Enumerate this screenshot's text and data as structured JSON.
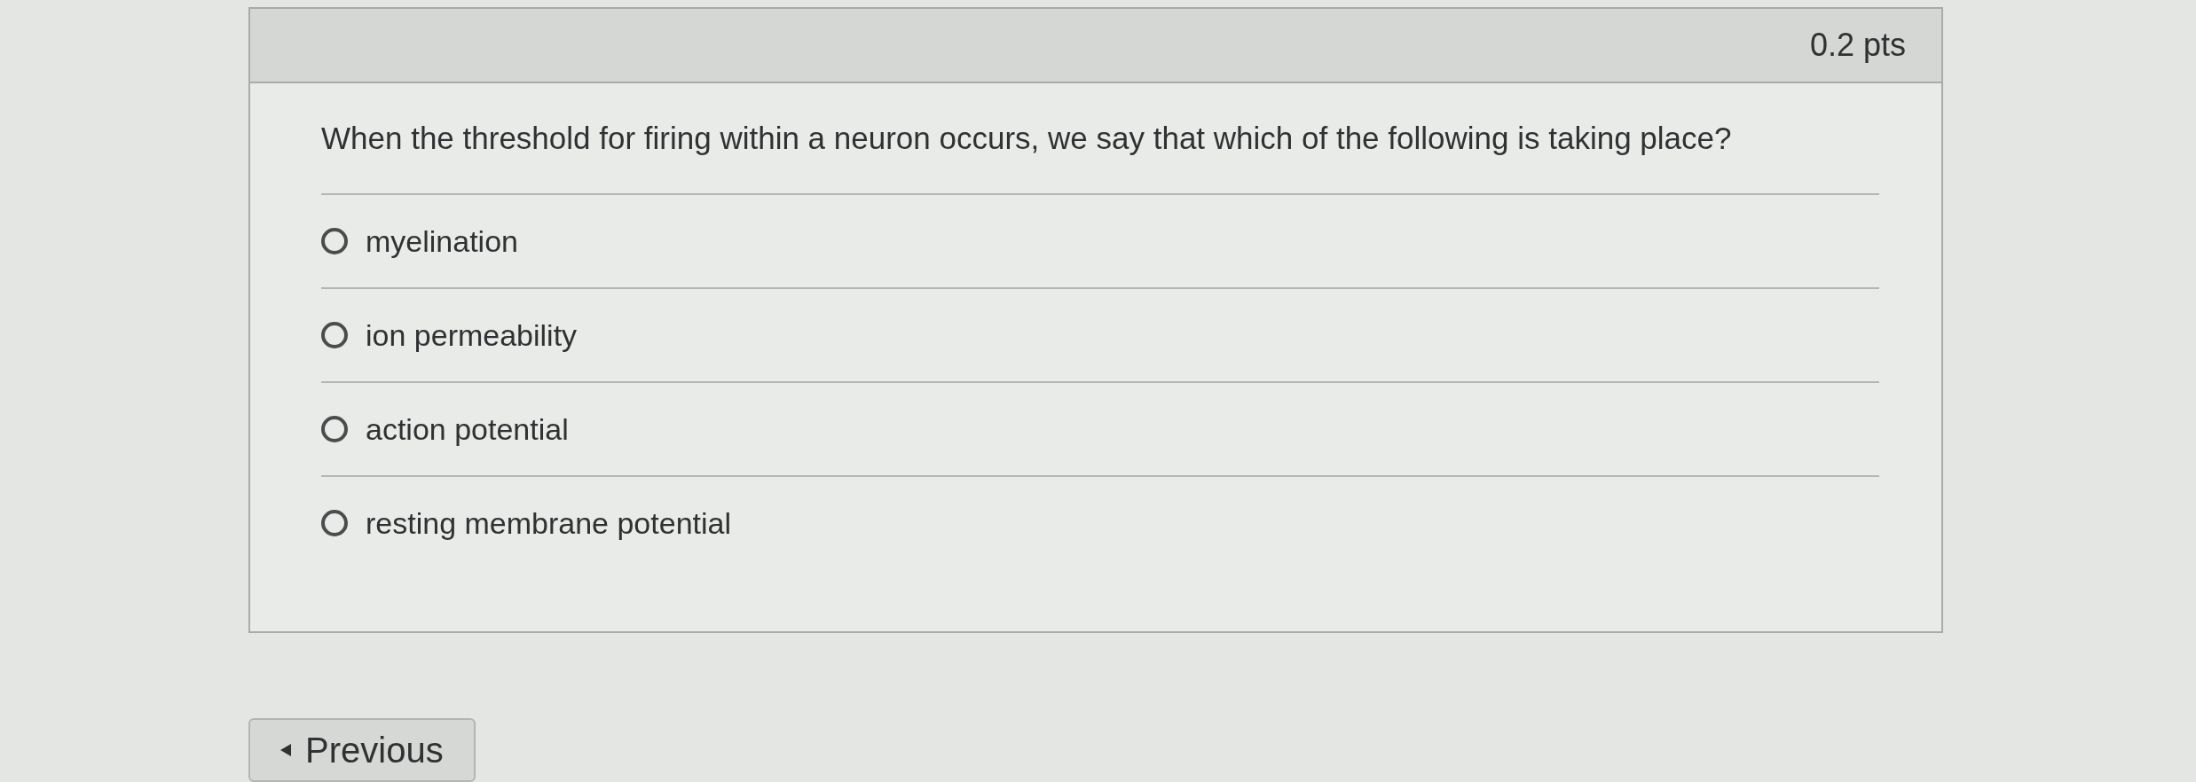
{
  "question": {
    "points": "0.2 pts",
    "text": "When the threshold for firing within a neuron occurs, we say that which of the following is taking place?",
    "answers": [
      {
        "label": "myelination",
        "selected": false
      },
      {
        "label": "ion permeability",
        "selected": false
      },
      {
        "label": "action potential",
        "selected": false
      },
      {
        "label": "resting membrane potential",
        "selected": false
      }
    ]
  },
  "navigation": {
    "previous": "Previous"
  }
}
